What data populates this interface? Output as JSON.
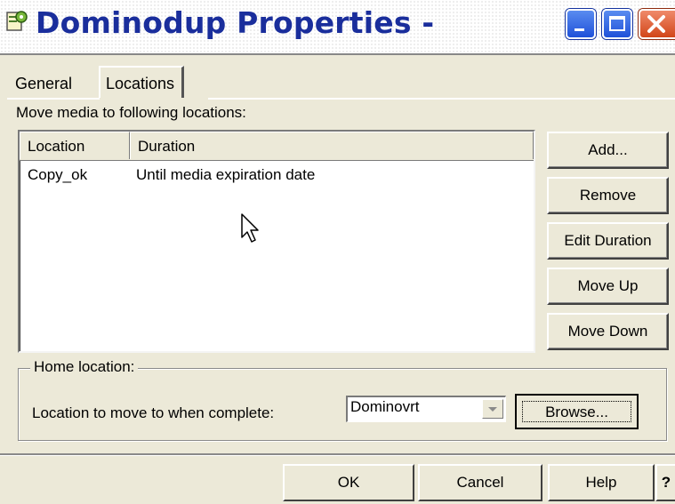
{
  "window": {
    "title": "Dominodup Properties -",
    "icons": [
      "app-icon",
      "minimize-icon",
      "maximize-icon",
      "close-icon"
    ]
  },
  "tabs": [
    {
      "label": "General",
      "active": false
    },
    {
      "label": "Locations",
      "active": true
    }
  ],
  "locations_tab": {
    "caption": "Move media to following locations:",
    "columns": [
      "Location",
      "Duration"
    ],
    "rows": [
      {
        "location": "Copy_ok",
        "duration": "Until media expiration date"
      }
    ],
    "buttons": {
      "add": "Add...",
      "remove": "Remove",
      "edit_duration": "Edit Duration",
      "move_up": "Move Up",
      "move_down": "Move Down"
    },
    "home": {
      "legend": "Home location:",
      "label": "Location to move to when complete:",
      "selected": "Dominovrt",
      "browse": "Browse..."
    }
  },
  "footer": {
    "ok": "OK",
    "cancel": "Cancel",
    "help": "Help",
    "whats_this": "?"
  },
  "colors": {
    "title_text": "#1a2e9c",
    "dialog_bg": "#ece9d8",
    "close_button": "#d24619",
    "window_button": "#1f51d9"
  }
}
